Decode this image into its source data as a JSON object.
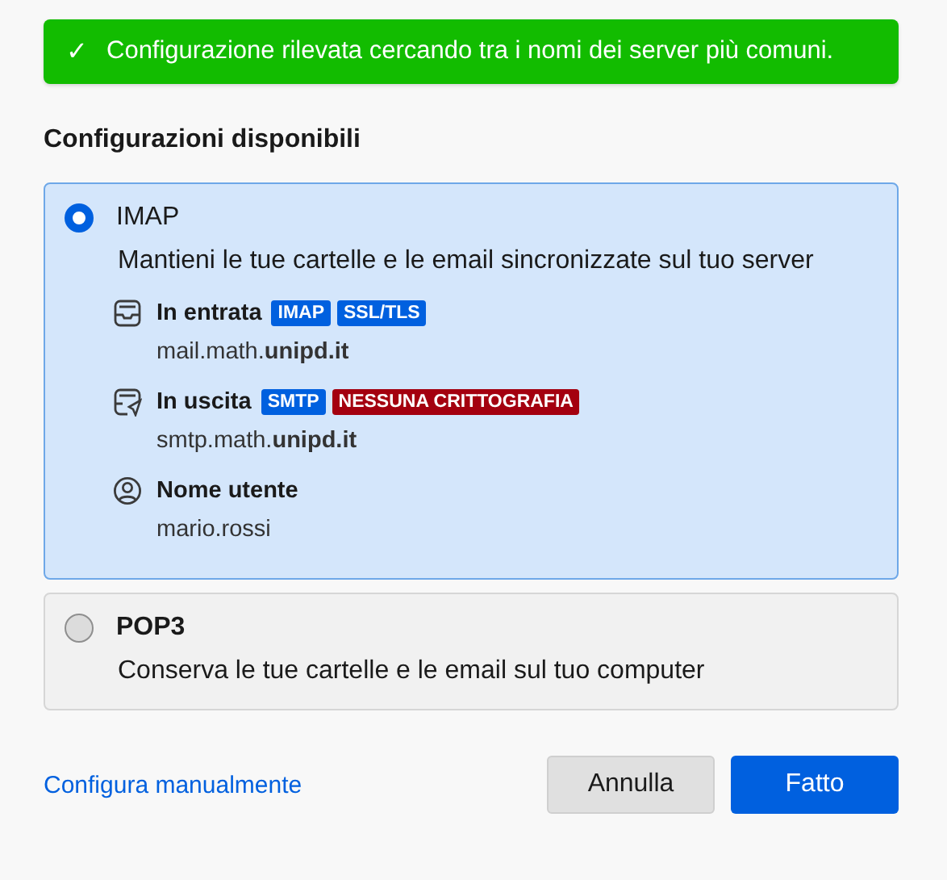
{
  "notification": {
    "icon": "✓",
    "text": "Configurazione rilevata cercando tra i nomi dei server più comuni."
  },
  "heading": "Configurazioni disponibili",
  "options": [
    {
      "name": "IMAP",
      "selected": true,
      "description": "Mantieni le tue cartelle e le email sincronizzate sul tuo server",
      "details": [
        {
          "kind": "incoming",
          "label": "In entrata",
          "badges": [
            {
              "text": "IMAP",
              "kind": "info"
            },
            {
              "text": "SSL/TLS",
              "kind": "info"
            }
          ],
          "value": "mail.math.**unipd.it**"
        },
        {
          "kind": "outgoing",
          "label": "In uscita",
          "badges": [
            {
              "text": "SMTP",
              "kind": "info"
            },
            {
              "text": "NESSUNA CRITTOGRAFIA",
              "kind": "warning"
            }
          ],
          "value": "smtp.math.**unipd.it**"
        },
        {
          "kind": "user",
          "label": "Nome utente",
          "value": "mario.rossi"
        }
      ]
    },
    {
      "name": "POP3",
      "selected": false,
      "description": "Conserva le tue cartelle e le email sul tuo computer"
    }
  ],
  "footer": {
    "link": "Configura manualmente",
    "buttons": [
      {
        "label": "Annulla",
        "kind": "secondary"
      },
      {
        "label": "Fatto",
        "kind": "primary"
      }
    ]
  }
}
